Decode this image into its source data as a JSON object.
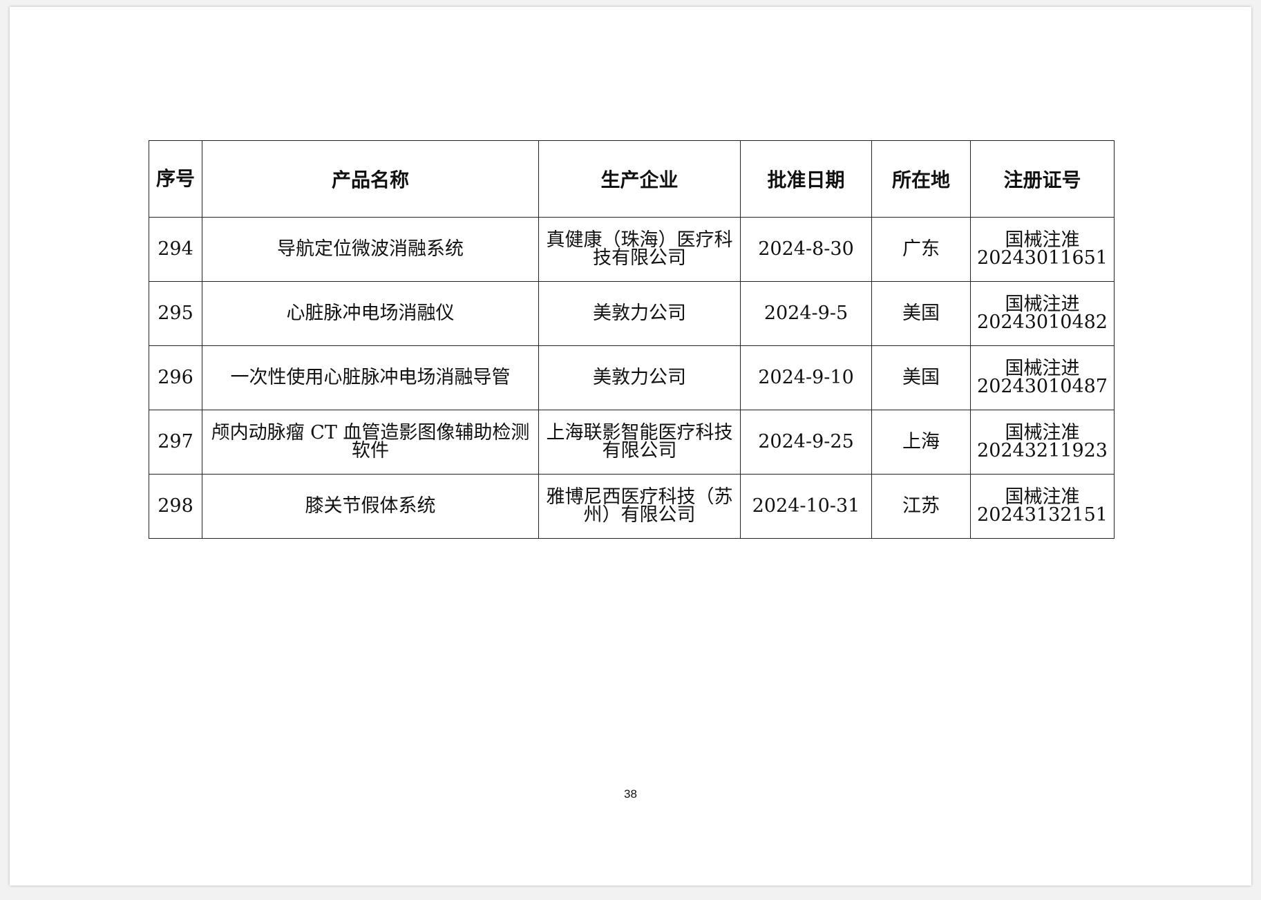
{
  "table": {
    "headers": {
      "seq": "序号",
      "product": "产品名称",
      "manufacturer": "生产企业",
      "date": "批准日期",
      "location": "所在地",
      "reg_no": "注册证号"
    },
    "rows": [
      {
        "seq": "294",
        "product": "导航定位微波消融系统",
        "manufacturer": "真健康（珠海）医疗科技有限公司",
        "date": "2024-8-30",
        "location": "广东",
        "reg_no": "国械注准 20243011651"
      },
      {
        "seq": "295",
        "product": "心脏脉冲电场消融仪",
        "manufacturer": "美敦力公司",
        "date": "2024-9-5",
        "location": "美国",
        "reg_no": "国械注进 20243010482"
      },
      {
        "seq": "296",
        "product": "一次性使用心脏脉冲电场消融导管",
        "manufacturer": "美敦力公司",
        "date": "2024-9-10",
        "location": "美国",
        "reg_no": "国械注进 20243010487"
      },
      {
        "seq": "297",
        "product": "颅内动脉瘤 CT 血管造影图像辅助检测软件",
        "manufacturer": "上海联影智能医疗科技有限公司",
        "date": "2024-9-25",
        "location": "上海",
        "reg_no": "国械注准 20243211923"
      },
      {
        "seq": "298",
        "product": "膝关节假体系统",
        "manufacturer": "雅博尼西医疗科技（苏州）有限公司",
        "date": "2024-10-31",
        "location": "江苏",
        "reg_no": "国械注准 20243132151"
      }
    ]
  },
  "page_number": "38"
}
